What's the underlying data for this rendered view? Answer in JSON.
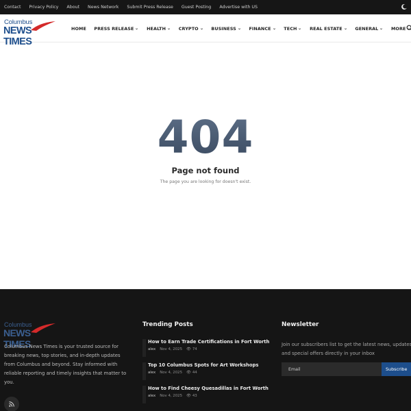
{
  "topbar": {
    "links": [
      "Contact",
      "Privacy Policy",
      "About",
      "News Network",
      "Submit Press Release",
      "Guest Posting",
      "Advertise with US"
    ]
  },
  "brand": {
    "logo_line1": "Columbus",
    "logo_line2": "NEWS TIMES"
  },
  "nav": {
    "items": [
      {
        "label": "HOME",
        "dropdown": false
      },
      {
        "label": "PRESS RELEASE",
        "dropdown": true
      },
      {
        "label": "HEALTH",
        "dropdown": true
      },
      {
        "label": "CRYPTO",
        "dropdown": true
      },
      {
        "label": "BUSINESS",
        "dropdown": true
      },
      {
        "label": "FINANCE",
        "dropdown": true
      },
      {
        "label": "TECH",
        "dropdown": true
      },
      {
        "label": "REAL ESTATE",
        "dropdown": true
      },
      {
        "label": "GENERAL",
        "dropdown": true
      },
      {
        "label": "MORE",
        "dropdown": true
      }
    ]
  },
  "error": {
    "code": "404",
    "title": "Page not found",
    "message": "The page you are looking for doesn't exist."
  },
  "footer": {
    "about": "Columbus News Times is your trusted source for breaking news, top stories, and in-depth updates from Columbus and beyond. Stay informed with reliable reporting and timely insights that matter to you.",
    "trending_title": "Trending Posts",
    "trending": [
      {
        "title": "How to Earn Trade Certifications in Fort Worth",
        "author": "alex",
        "date": "Nov 4, 2025",
        "views": "74"
      },
      {
        "title": "Top 10 Columbus Spots for Art Workshops",
        "author": "alex",
        "date": "Nov 4, 2025",
        "views": "44"
      },
      {
        "title": "How to Find Cheesy Quesadillas in Fort Worth",
        "author": "alex",
        "date": "Nov 4, 2025",
        "views": "43"
      }
    ],
    "newsletter_title": "Newsletter",
    "newsletter_text": "Join our subscribers list to get the latest news, updates and special offers directly in your inbox",
    "email_placeholder": "Email",
    "subscribe_label": "Subscribe"
  },
  "colors": {
    "topbar_bg": "#161616",
    "footer_bg": "#151515",
    "brand_blue": "#1d4e8c",
    "logo_red": "#d42a2a"
  },
  "icons": {
    "dark_mode": "moon-icon",
    "search": "search-icon",
    "rss": "rss-icon",
    "views": "eye-icon",
    "dropdown": "chevron-down-icon"
  }
}
